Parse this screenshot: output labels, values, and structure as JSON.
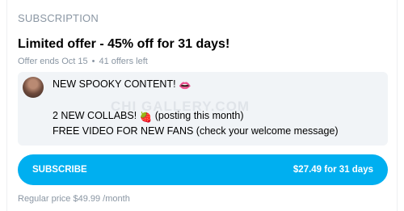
{
  "section": {
    "title": "SUBSCRIPTION"
  },
  "offer": {
    "title": "Limited offer - 45% off for 31 days!",
    "ends": "Offer ends Oct 15",
    "separator": "•",
    "left": "41 offers left"
  },
  "message": {
    "line1": "NEW SPOOKY CONTENT!",
    "line1_emoji": "👄",
    "line2_a": "2 NEW COLLABS!",
    "line2_emoji": "🍓",
    "line2_b": "(posting this month)",
    "line3": "FREE VIDEO FOR NEW FANS (check your welcome message)"
  },
  "watermark": "CHI GALLERY.COM",
  "subscribe": {
    "label": "SUBSCRIBE",
    "price": "$27.49 for 31 days"
  },
  "regular": "Regular price $49.99 /month",
  "colors": {
    "accent": "#00aff0",
    "muted": "#8a96a3",
    "panel": "#f1f4f7"
  },
  "icons": {
    "avatar": "user-avatar"
  }
}
